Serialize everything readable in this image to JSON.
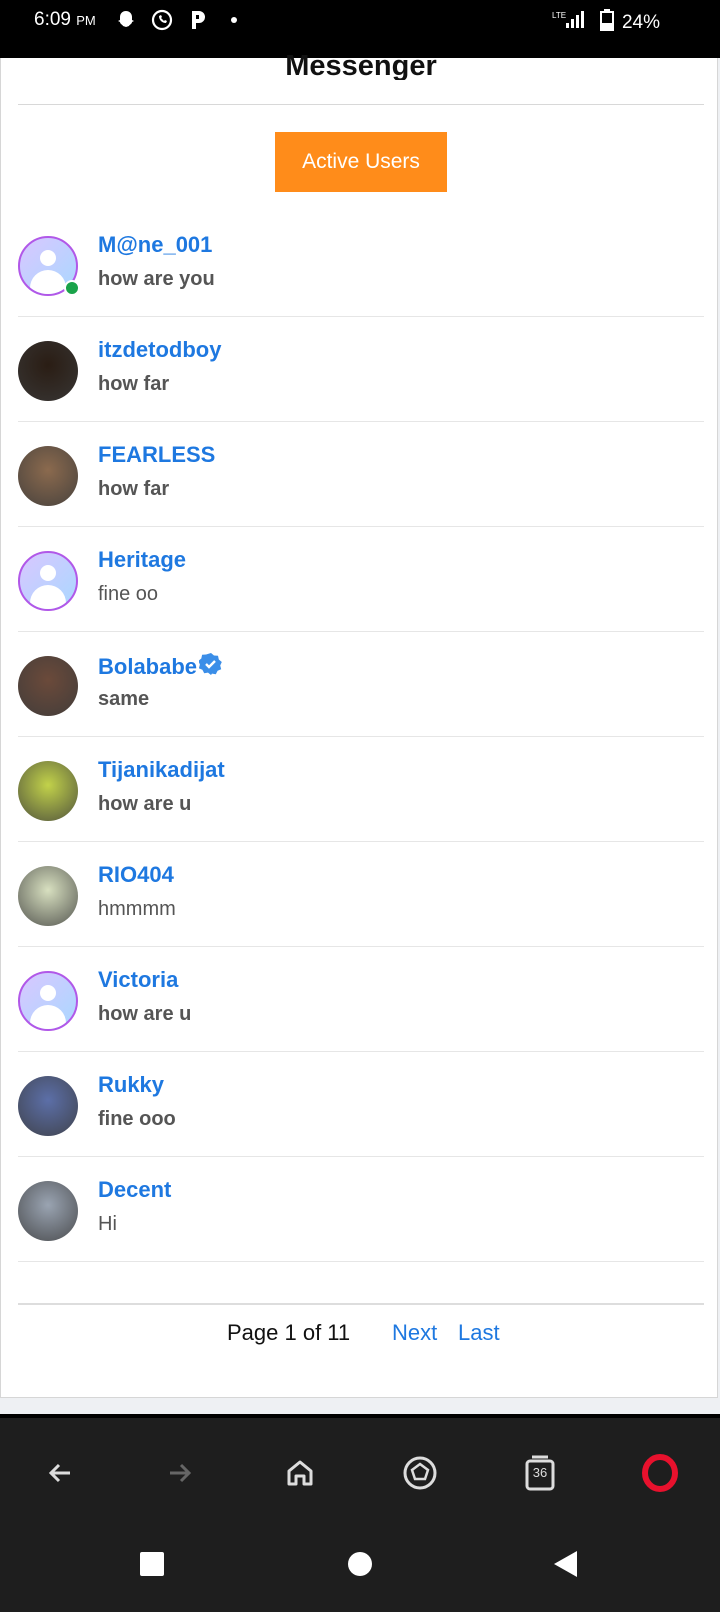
{
  "status_bar": {
    "time": "6:09",
    "ampm": "PM",
    "network": "LTE",
    "battery": "24%"
  },
  "header": {
    "title": "Messenger",
    "active_users_label": "Active Users"
  },
  "conversations": [
    {
      "name": "M@ne_001",
      "message": "how are you",
      "bold": true,
      "online": true,
      "verified": false,
      "avatar": "default-avatar-icon",
      "avatar_color": "#333"
    },
    {
      "name": "itzdetodboy",
      "message": "how far",
      "bold": true,
      "online": false,
      "verified": false,
      "avatar": "photo",
      "avatar_color": "#2a1d14"
    },
    {
      "name": "FEARLESS",
      "message": "how far",
      "bold": true,
      "online": false,
      "verified": false,
      "avatar": "photo",
      "avatar_color": "#8b6a4e"
    },
    {
      "name": "Heritage",
      "message": "fine oo",
      "bold": false,
      "online": false,
      "verified": false,
      "avatar": "default-avatar-icon",
      "avatar_color": "#333"
    },
    {
      "name": "Bolababe",
      "message": "same",
      "bold": true,
      "online": false,
      "verified": true,
      "avatar": "photo",
      "avatar_color": "#6b4a3a"
    },
    {
      "name": "Tijanikadijat",
      "message": "how are u",
      "bold": true,
      "online": false,
      "verified": false,
      "avatar": "photo",
      "avatar_color": "#c2d24a"
    },
    {
      "name": "RIO404",
      "message": "hmmmm",
      "bold": false,
      "online": false,
      "verified": false,
      "avatar": "photo",
      "avatar_color": "#d8e0c0"
    },
    {
      "name": "Victoria",
      "message": "how are u",
      "bold": true,
      "online": false,
      "verified": false,
      "avatar": "default-avatar-icon",
      "avatar_color": "#333"
    },
    {
      "name": "Rukky",
      "message": "fine ooo",
      "bold": true,
      "online": false,
      "verified": false,
      "avatar": "photo",
      "avatar_color": "#5c6fa8"
    },
    {
      "name": "Decent",
      "message": "Hi",
      "bold": false,
      "online": false,
      "verified": false,
      "avatar": "photo",
      "avatar_color": "#9aa4b2"
    }
  ],
  "pagination": {
    "text": "Page 1 of 11",
    "next": "Next",
    "last": "Last"
  },
  "browser": {
    "tab_count": "36"
  },
  "colors": {
    "accent": "#ff8c1a",
    "link": "#1e78e0",
    "online": "#1aa34a",
    "verified": "#3b8ee8"
  }
}
